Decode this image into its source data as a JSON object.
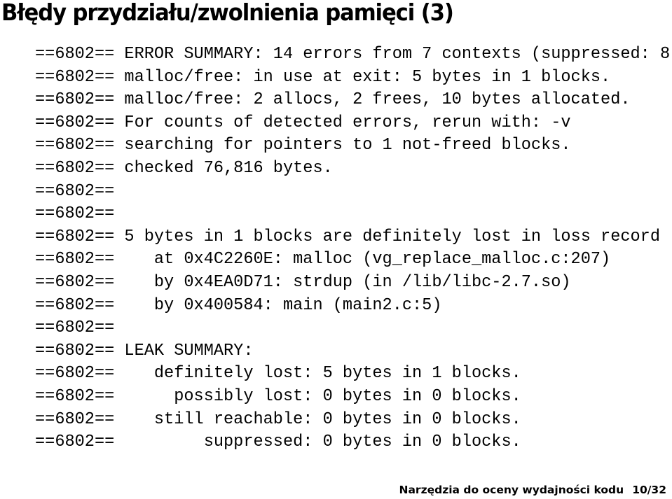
{
  "slide": {
    "title": "Błędy przydziału/zwolnienia pamięci (3)",
    "lines": [
      "==6802== ERROR SUMMARY: 14 errors from 7 contexts (suppressed: 8",
      "==6802== malloc/free: in use at exit: 5 bytes in 1 blocks.",
      "==6802== malloc/free: 2 allocs, 2 frees, 10 bytes allocated.",
      "==6802== For counts of detected errors, rerun with: -v",
      "==6802== searching for pointers to 1 not-freed blocks.",
      "==6802== checked 76,816 bytes.",
      "==6802==",
      "==6802==",
      "==6802== 5 bytes in 1 blocks are definitely lost in loss record",
      "==6802==    at 0x4C2260E: malloc (vg_replace_malloc.c:207)",
      "==6802==    by 0x4EA0D71: strdup (in /lib/libc-2.7.so)",
      "==6802==    by 0x400584: main (main2.c:5)",
      "==6802==",
      "==6802== LEAK SUMMARY:",
      "==6802==    definitely lost: 5 bytes in 1 blocks.",
      "==6802==      possibly lost: 0 bytes in 0 blocks.",
      "==6802==    still reachable: 0 bytes in 0 blocks.",
      "==6802==         suppressed: 0 bytes in 0 blocks."
    ],
    "footer": {
      "text": "Narzędzia do oceny wydajności kodu",
      "page": "10/32"
    }
  }
}
